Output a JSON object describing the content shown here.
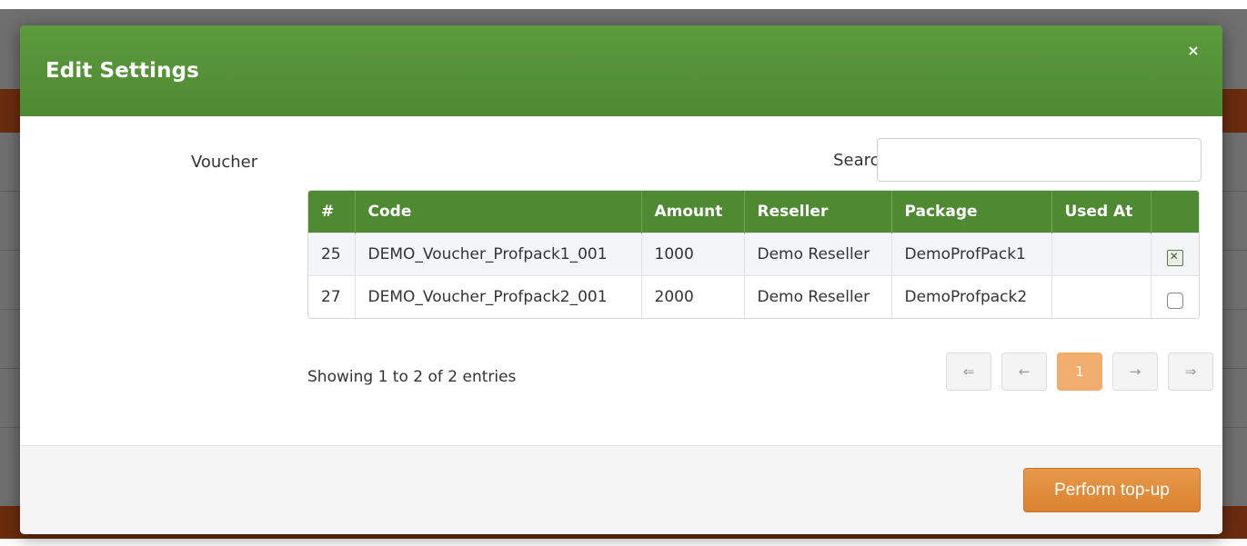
{
  "modal": {
    "title": "Edit Settings",
    "close_label": "×"
  },
  "form": {
    "field_label": "Voucher",
    "search_label": "Search:",
    "search_value": "",
    "search_placeholder": ""
  },
  "table": {
    "columns": [
      "#",
      "Code",
      "Amount",
      "Reseller",
      "Package",
      "Used At",
      ""
    ],
    "rows": [
      {
        "id": "25",
        "code": "DEMO_Voucher_Profpack1_001",
        "amount": "1000",
        "reseller": "Demo Reseller",
        "package": "DemoProfPack1",
        "used_at": "",
        "selected": true
      },
      {
        "id": "27",
        "code": "DEMO_Voucher_Profpack2_001",
        "amount": "2000",
        "reseller": "Demo Reseller",
        "package": "DemoProfpack2",
        "used_at": "",
        "selected": false
      }
    ]
  },
  "info_text": "Showing 1 to 2 of 2 entries",
  "pagination": {
    "first": "⇐",
    "prev": "←",
    "current": "1",
    "next": "→",
    "last": "⇒"
  },
  "footer": {
    "primary_label": "Perform top-up"
  },
  "colors": {
    "header_green": "#4e8a32",
    "accent_orange": "#db8230",
    "page_active": "#f0ad6e"
  }
}
